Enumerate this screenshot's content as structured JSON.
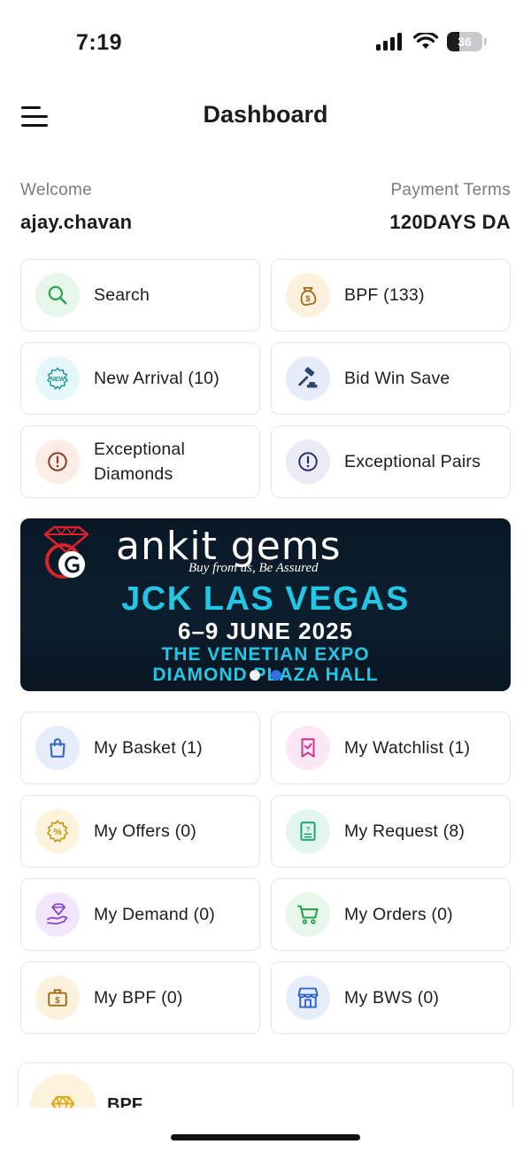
{
  "status_bar": {
    "time": "7:19",
    "battery": "36"
  },
  "header": {
    "title": "Dashboard"
  },
  "user": {
    "welcome_label": "Welcome",
    "username": "ajay.chavan",
    "payment_terms_label": "Payment Terms",
    "payment_terms_value": "120DAYS DA"
  },
  "quick_actions": [
    {
      "label": "Search",
      "icon": "search-icon",
      "color": "#2e9e4f"
    },
    {
      "label": "BPF (133)",
      "icon": "money-bag-icon",
      "color": "#a06a17"
    },
    {
      "label": "New Arrival (10)",
      "icon": "new-badge-icon",
      "color": "#1c8f9b"
    },
    {
      "label": "Bid Win Save",
      "icon": "gavel-icon",
      "color": "#27456e"
    },
    {
      "label": "Exceptional Diamonds",
      "icon": "alert-circle-icon",
      "color": "#8a3a1f"
    },
    {
      "label": "Exceptional Pairs",
      "icon": "alert-circle-icon",
      "color": "#2a2a6e"
    }
  ],
  "banner": {
    "brand": "ankit gems",
    "tagline": "Buy from us, Be Assured",
    "headline": "JCK LAS VEGAS",
    "dates": "6–9 JUNE 2025",
    "venue_line1": "THE VENETIAN EXPO",
    "venue_line2": "DIAMOND PLAZA HALL",
    "slides_total": 2,
    "active_slide": 1
  },
  "my_items": [
    {
      "label": "My Basket (1)",
      "icon": "shopping-bag-icon",
      "color": "#2d5fd1"
    },
    {
      "label": "My Watchlist (1)",
      "icon": "bookmark-check-icon",
      "color": "#d0318e"
    },
    {
      "label": "My Offers (0)",
      "icon": "discount-icon",
      "color": "#c9920c"
    },
    {
      "label": "My Request (8)",
      "icon": "document-icon",
      "color": "#19a473"
    },
    {
      "label": "My Demand (0)",
      "icon": "diamond-hand-icon",
      "color": "#8b3fd3"
    },
    {
      "label": "My Orders (0)",
      "icon": "cart-icon",
      "color": "#2e9e4f"
    },
    {
      "label": "My BPF (0)",
      "icon": "briefcase-dollar-icon",
      "color": "#a06a17"
    },
    {
      "label": "My BWS (0)",
      "icon": "store-icon",
      "color": "#2d5fd1"
    }
  ],
  "bottom_card": {
    "label": "BPF",
    "icon": "diamond-icon",
    "color": "#e0a91c"
  }
}
